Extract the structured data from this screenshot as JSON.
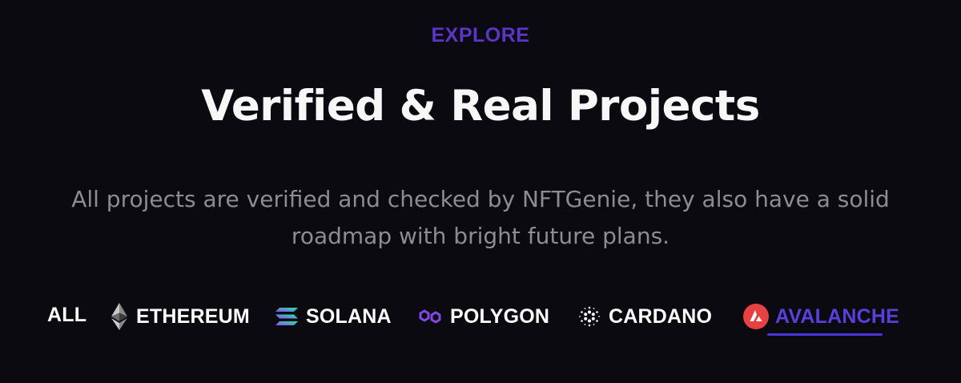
{
  "section": {
    "eyebrow": "EXPLORE",
    "title": "Verified & Real Projects",
    "subtitle_line1": "All projects are verified and checked by NFTGenie, they also have a solid",
    "subtitle_line2": "roadmap with bright future plans."
  },
  "tabs": [
    {
      "label": "ALL",
      "icon": "none",
      "active": false
    },
    {
      "label": "ETHEREUM",
      "icon": "ethereum-icon",
      "active": false
    },
    {
      "label": "SOLANA",
      "icon": "solana-icon",
      "active": false
    },
    {
      "label": "POLYGON",
      "icon": "polygon-icon",
      "active": false
    },
    {
      "label": "CARDANO",
      "icon": "cardano-icon",
      "active": false
    },
    {
      "label": "AVALANCHE",
      "icon": "avalanche-icon",
      "active": true
    }
  ],
  "colors": {
    "background": "#0b0a10",
    "accent": "#5b3fdd",
    "title": "#f7f7f7",
    "subtitle": "#8c8c91",
    "avalanche_red": "#e84142"
  }
}
